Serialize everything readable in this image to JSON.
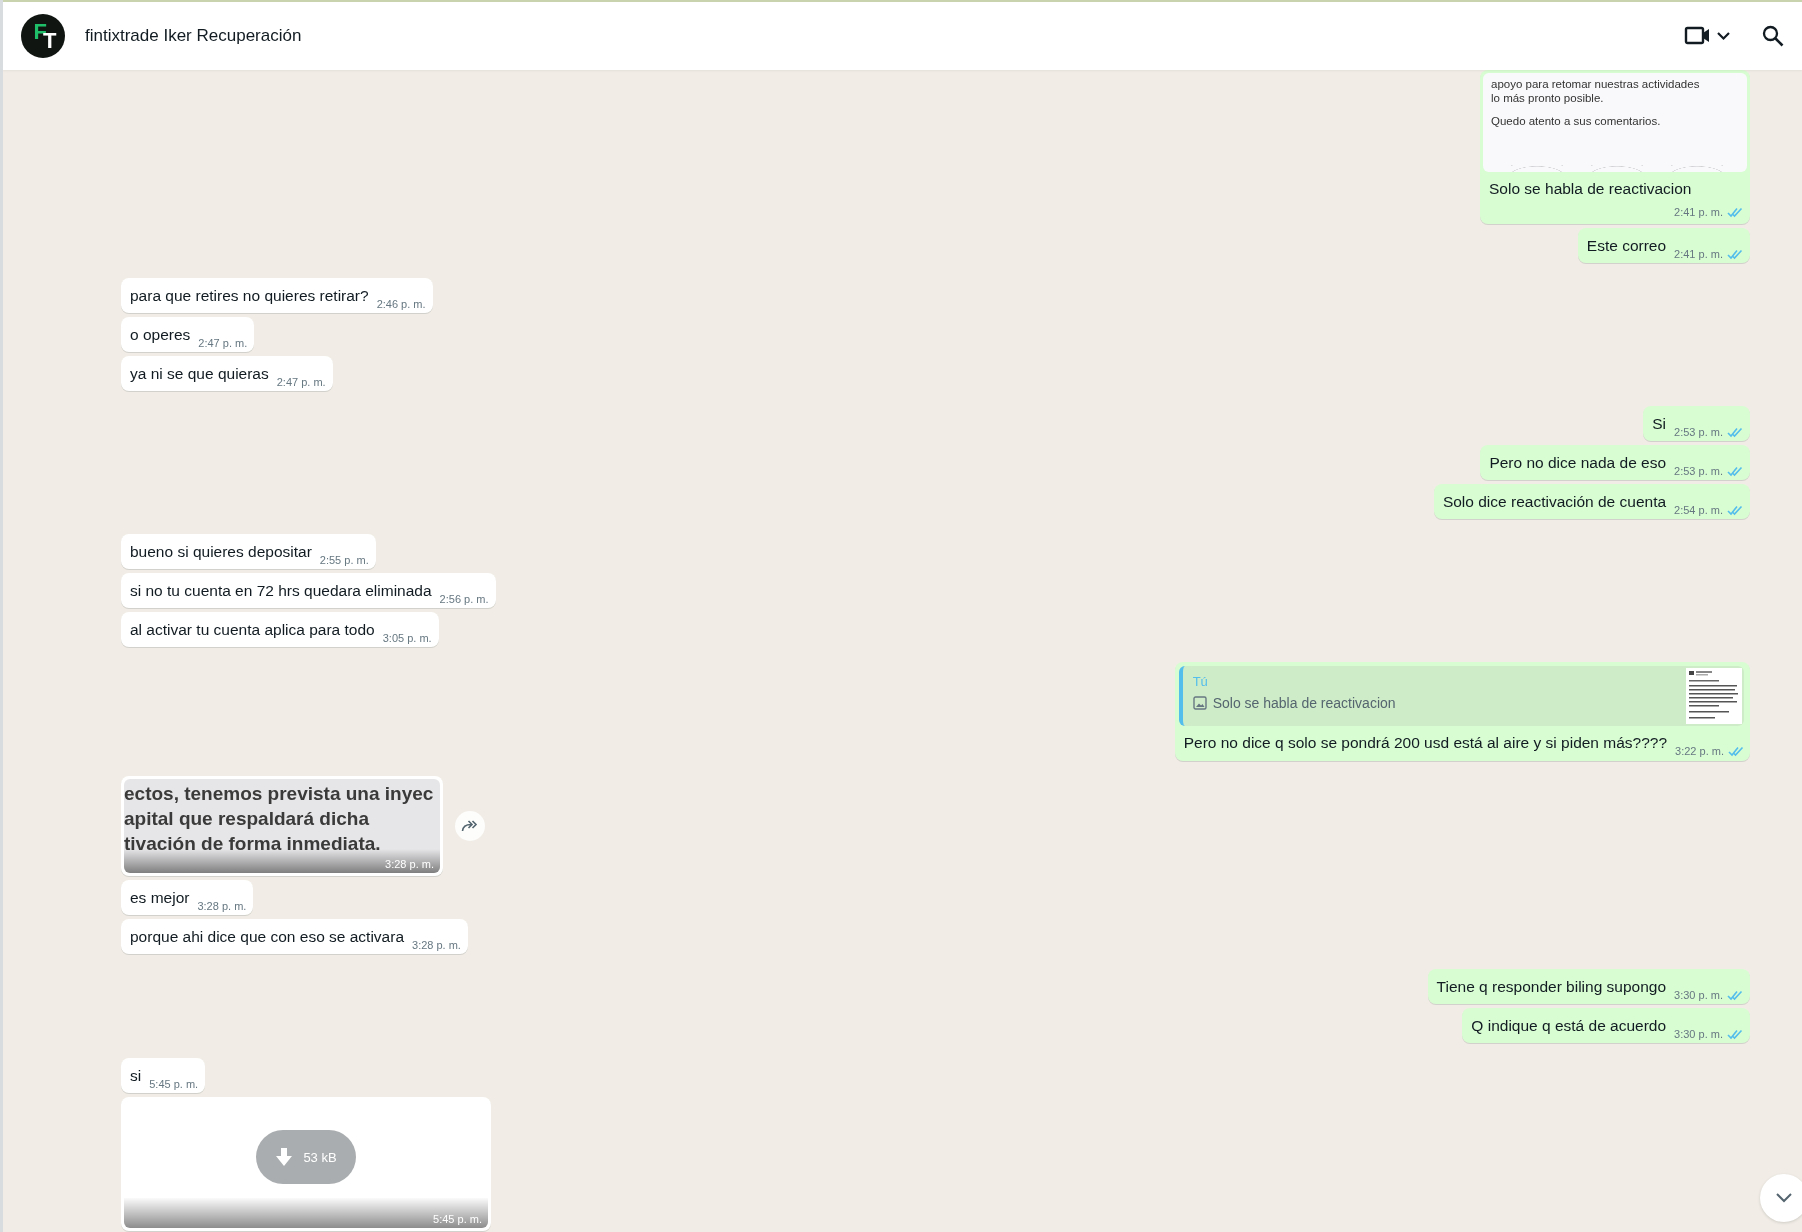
{
  "header": {
    "avatar_letters": [
      "F",
      "T"
    ],
    "title": "fintixtrade Iker Recuperación"
  },
  "groups": [
    {
      "outgoing": true,
      "messages": [
        {
          "kind": "image",
          "paragraphs": [
            [
              "apoyo para retomar nuestras actividades",
              "lo más pronto posible."
            ],
            [
              "Quedo atento a sus comentarios."
            ]
          ],
          "caption": "Solo se habla de reactivacion",
          "time": "2:41 p. m.",
          "read": true
        },
        {
          "kind": "text",
          "text": "Este correo",
          "time": "2:41 p. m.",
          "read": true
        }
      ]
    },
    {
      "outgoing": false,
      "messages": [
        {
          "kind": "text",
          "text": "para que retires no quieres retirar?",
          "time": "2:46 p. m."
        },
        {
          "kind": "text",
          "text": "o operes",
          "time": "2:47 p. m."
        },
        {
          "kind": "text",
          "text": "ya ni se que quieras",
          "time": "2:47 p. m."
        }
      ]
    },
    {
      "outgoing": true,
      "messages": [
        {
          "kind": "text",
          "text": "Si",
          "time": "2:53 p. m.",
          "read": true
        },
        {
          "kind": "text",
          "text": "Pero no dice nada de eso",
          "time": "2:53 p. m.",
          "read": true
        },
        {
          "kind": "text",
          "text": "Solo dice reactivación de cuenta",
          "time": "2:54 p. m.",
          "read": true
        }
      ]
    },
    {
      "outgoing": false,
      "messages": [
        {
          "kind": "text",
          "text": "bueno si quieres depositar",
          "time": "2:55 p. m."
        },
        {
          "kind": "text",
          "text": "si no tu cuenta en 72 hrs quedara eliminada",
          "time": "2:56 p. m."
        },
        {
          "kind": "text",
          "text": "al activar tu cuenta aplica para todo",
          "time": "3:05 p. m."
        }
      ]
    },
    {
      "outgoing": true,
      "messages": [
        {
          "kind": "quote",
          "quote_author": "Tú",
          "quote_text": "Solo se habla de reactivacion",
          "text": "Pero no dice q solo se pondrá 200 usd está al aire y si piden más????",
          "time": "3:22 p. m.",
          "read": true
        }
      ]
    },
    {
      "outgoing": false,
      "messages": [
        {
          "kind": "image",
          "paragraphs": [
            [
              "ectos, tenemos prevista una inyec",
              "apital que respaldará dicha",
              "tivación de forma inmediata."
            ]
          ],
          "time": "3:28 p. m.",
          "forward": true
        },
        {
          "kind": "text",
          "text": "es mejor",
          "time": "3:28 p. m."
        },
        {
          "kind": "text",
          "text": "porque ahi dice que con eso se activara",
          "time": "3:28 p. m."
        }
      ]
    },
    {
      "outgoing": true,
      "messages": [
        {
          "kind": "text",
          "text": "Tiene q responder biling supongo",
          "time": "3:30 p. m.",
          "read": true
        },
        {
          "kind": "text",
          "text": "Q indique q está de acuerdo",
          "time": "3:30 p. m.",
          "read": true
        }
      ]
    },
    {
      "outgoing": false,
      "messages": [
        {
          "kind": "text",
          "text": "si",
          "time": "5:45 p. m."
        },
        {
          "kind": "file",
          "size": "53 kB",
          "time": "5:45 p. m."
        }
      ]
    }
  ]
}
